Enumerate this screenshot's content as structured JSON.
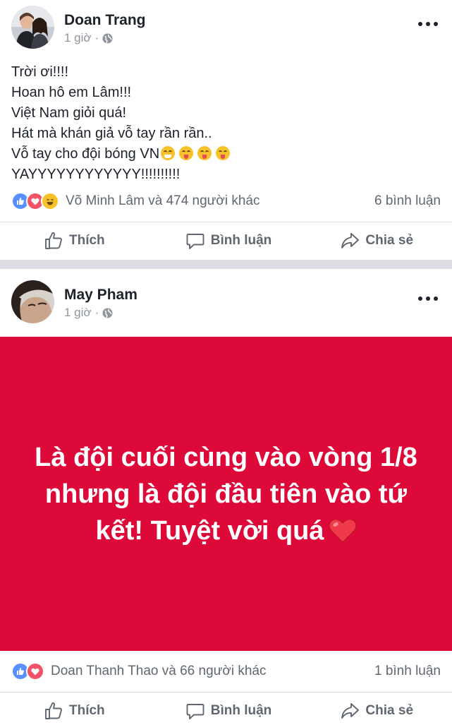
{
  "colors": {
    "banner": "#dc0939",
    "like_blue": "#5890ff",
    "love_red": "#f25268",
    "haha_yellow": "#f7c229",
    "divider": "#dcdee3"
  },
  "posts": [
    {
      "author": "Doan Trang",
      "time": "1 giờ",
      "privacy_icon": "globe-icon",
      "text_lines": [
        "Trời ơi!!!!",
        "Hoan hô em Lâm!!!",
        "Việt Nam giỏi quá!",
        "Hát mà khán giả vỗ tay rần rần..",
        "Vỗ tay cho đội bóng VN",
        "YAYYYYYYYYYYYY!!!!!!!!!!"
      ],
      "reaction_icons": [
        "like-icon",
        "love-icon",
        "haha-icon"
      ],
      "reactions_text": "Võ Minh Lâm và 474 người khác",
      "comments": "6 bình luận",
      "actions": {
        "like": "Thích",
        "comment": "Bình luận",
        "share": "Chia sẻ"
      }
    },
    {
      "author": "May Pham",
      "time": "1 giờ",
      "privacy_icon": "globe-icon",
      "banner_text": "Là đội cuối cùng vào vòng 1/8 nhưng là đội đầu tiên vào tứ kết! Tuyệt vời quá",
      "reaction_icons": [
        "like-icon",
        "love-icon"
      ],
      "reactions_text": "Doan Thanh Thao và 66 người khác",
      "comments": "1 bình luận",
      "actions": {
        "like": "Thích",
        "comment": "Bình luận",
        "share": "Chia sẻ"
      }
    }
  ]
}
